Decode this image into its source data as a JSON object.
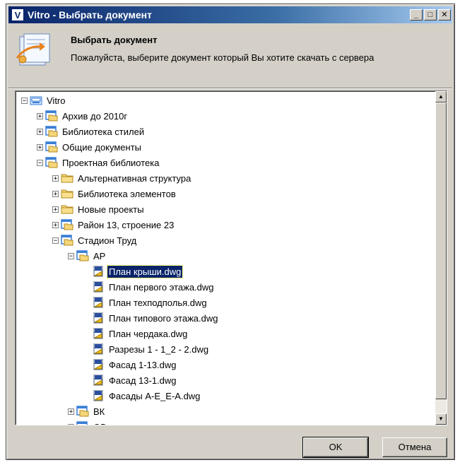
{
  "window": {
    "title": "Vitro - Выбрать документ",
    "app_icon_letter": "V"
  },
  "header": {
    "title": "Выбрать документ",
    "description": "Пожалуйста, выберите документ который Вы хотите скачать с сервера"
  },
  "tree": [
    {
      "label": "Vitro",
      "level": 0,
      "expander": "-",
      "icon": "server-icon",
      "name": "tree-item-vitro"
    },
    {
      "label": "Архив до 2010г",
      "level": 1,
      "expander": "+",
      "icon": "project-folder-icon",
      "name": "tree-item-archive"
    },
    {
      "label": "Библиотека стилей",
      "level": 1,
      "expander": "+",
      "icon": "project-folder-icon",
      "name": "tree-item-styles-library"
    },
    {
      "label": "Общие документы",
      "level": 1,
      "expander": "+",
      "icon": "project-folder-icon",
      "name": "tree-item-shared-docs"
    },
    {
      "label": "Проектная библиотека",
      "level": 1,
      "expander": "-",
      "icon": "project-folder-icon",
      "name": "tree-item-project-library"
    },
    {
      "label": "Альтернативная структура",
      "level": 2,
      "expander": "+",
      "icon": "folder-icon",
      "name": "tree-item-alt-structure"
    },
    {
      "label": "Библиотека элементов",
      "level": 2,
      "expander": "+",
      "icon": "folder-icon",
      "name": "tree-item-elements-library"
    },
    {
      "label": "Новые проекты",
      "level": 2,
      "expander": "+",
      "icon": "folder-icon",
      "name": "tree-item-new-projects"
    },
    {
      "label": "Район 13, строение 23",
      "level": 2,
      "expander": "+",
      "icon": "project-folder-icon",
      "name": "tree-item-district-13"
    },
    {
      "label": "Стадион Труд",
      "level": 2,
      "expander": "-",
      "icon": "project-folder-icon",
      "name": "tree-item-stadium"
    },
    {
      "label": "АР",
      "level": 3,
      "expander": "-",
      "icon": "project-folder-icon",
      "name": "tree-item-ar"
    },
    {
      "label": "План крыши.dwg",
      "level": 4,
      "expander": "",
      "icon": "dwg-file-icon",
      "name": "tree-item-file",
      "selected": true
    },
    {
      "label": "План первого этажа.dwg",
      "level": 4,
      "expander": "",
      "icon": "dwg-file-icon",
      "name": "tree-item-file"
    },
    {
      "label": "План техподполья.dwg",
      "level": 4,
      "expander": "",
      "icon": "dwg-file-icon",
      "name": "tree-item-file"
    },
    {
      "label": "План типового этажа.dwg",
      "level": 4,
      "expander": "",
      "icon": "dwg-file-icon",
      "name": "tree-item-file"
    },
    {
      "label": "План чердака.dwg",
      "level": 4,
      "expander": "",
      "icon": "dwg-file-icon",
      "name": "tree-item-file"
    },
    {
      "label": "Разрезы 1 - 1_2 - 2.dwg",
      "level": 4,
      "expander": "",
      "icon": "dwg-file-icon",
      "name": "tree-item-file"
    },
    {
      "label": "Фасад 1-13.dwg",
      "level": 4,
      "expander": "",
      "icon": "dwg-file-icon",
      "name": "tree-item-file"
    },
    {
      "label": "Фасад 13-1.dwg",
      "level": 4,
      "expander": "",
      "icon": "dwg-file-icon",
      "name": "tree-item-file"
    },
    {
      "label": "Фасады А-Е_Е-А.dwg",
      "level": 4,
      "expander": "",
      "icon": "dwg-file-icon",
      "name": "tree-item-file"
    },
    {
      "label": "ВК",
      "level": 3,
      "expander": "+",
      "icon": "project-folder-icon",
      "name": "tree-item-vk"
    },
    {
      "label": "ОВ",
      "level": 3,
      "expander": "+",
      "icon": "project-folder-icon",
      "name": "tree-item-ov"
    }
  ],
  "buttons": {
    "ok": "OK",
    "cancel": "Отмена"
  },
  "colors": {
    "selection": "#0a246a",
    "folder": "#f5d77a",
    "project_folder_frame": "#3a7fd5"
  }
}
